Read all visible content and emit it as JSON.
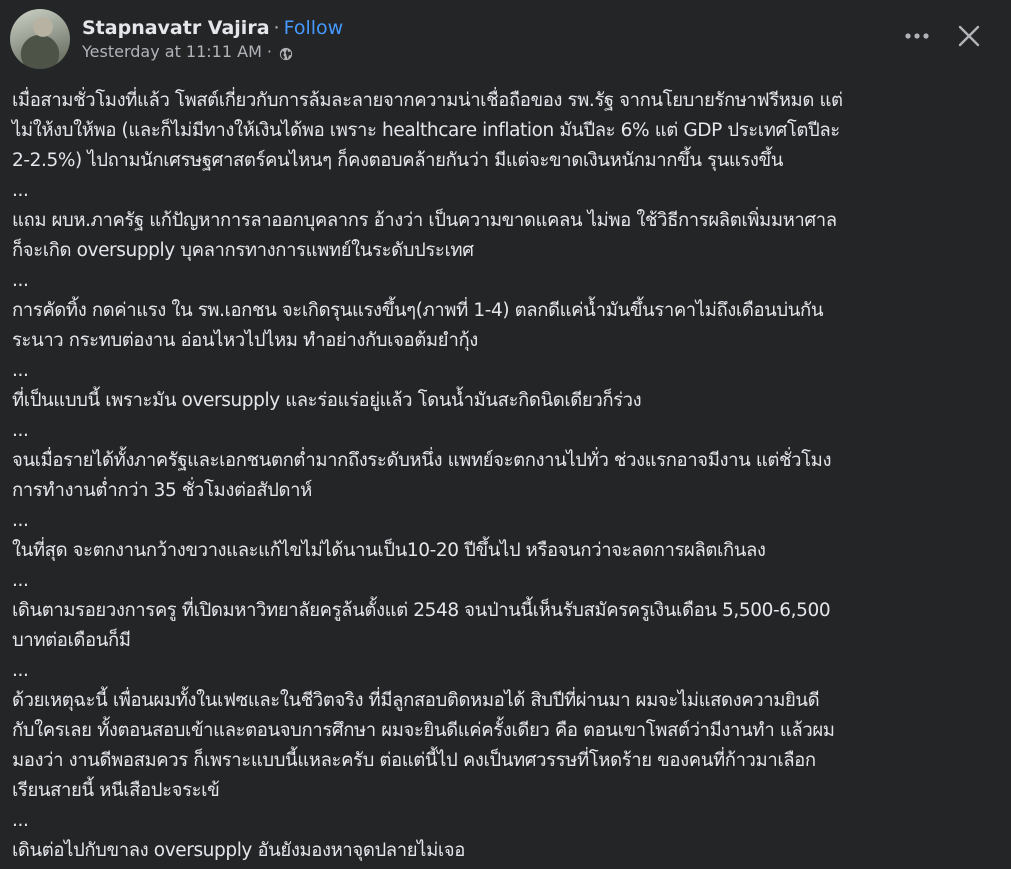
{
  "author": {
    "name": "Stapnavatr Vajira",
    "separator": "·",
    "follow_label": "Follow",
    "timestamp": "Yesterday at 11:11 AM",
    "time_separator": "·",
    "privacy_icon": "globe-icon"
  },
  "actions": {
    "more_icon": "more-horizontal-icon",
    "close_icon": "close-icon"
  },
  "lines": [
    "เมื่อสามชั่วโมงที่แล้ว โพสต์เกี่ยวกับการล้มละลายจากความน่าเชื่อถือของ รพ.รัฐ จากนโยบายรักษาฟรีหมด แต่",
    "ไม่ให้งบให้พอ (และก็ไม่มีทางให้เงินได้พอ เพราะ healthcare inflation มันปีละ 6% แต่ GDP ประเทศโตปีละ",
    "2-2.5%) ไปถามนักเศรษฐศาสตร์คนไหนๆ ก็คงตอบคล้ายกันว่า มีแต่จะขาดเงินหนักมากขึ้น รุนแรงขึ้น",
    "...",
    "แถม ผบห.ภาครัฐ แก้ปัญหาการลาออกบุคลากร อ้างว่า เป็นความขาดแคลน ไม่พอ ใช้วิธีการผลิตเพิ่มมหาศาล",
    "ก็จะเกิด oversupply บุคลากรทางการแพทย์ในระดับประเทศ",
    "...",
    "การคัดทิ้ง กดค่าแรง ใน รพ.เอกชน จะเกิดรุนแรงขึ้นๆ(ภาพที่ 1-4) ตลกดีแค่น้ำมันขึ้นราคาไม่ถึงเดือนบ่นกัน",
    "ระนาว กระทบต่องาน อ่อนไหวไปไหม ทำอย่างกับเจอต้มยำกุ้ง",
    "...",
    "ที่เป็นแบบนี้ เพราะมัน oversupply และร่อแร่อยู่แล้ว โดนน้ำมันสะกิดนิดเดียวก็ร่วง",
    "...",
    "จนเมื่อรายได้ทั้งภาครัฐและเอกชนตกต่ำมากถึงระดับหนึ่ง แพทย์จะตกงานไปทั่ว ช่วงแรกอาจมีงาน แต่ชั่วโมง",
    "การทำงานต่ำกว่า 35 ชั่วโมงต่อสัปดาห์",
    "...",
    "ในที่สุด จะตกงานกว้างขวางและแก้ไขไม่ได้นานเป็น10-20 ปีขึ้นไป หรือจนกว่าจะลดการผลิตเกินลง",
    "...",
    "เดินตามรอยวงการครู ที่เปิดมหาวิทยาลัยครูล้นตั้งแต่ 2548 จนป่านนี้เห็นรับสมัครครูเงินเดือน 5,500-6,500",
    "บาทต่อเดือนก็มี",
    "...",
    "ด้วยเหตุฉะนี้ เพื่อนผมทั้งในเฟซและในชีวิตจริง ที่มีลูกสอบติดหมอได้ สิบปีที่ผ่านมา ผมจะไม่แสดงความยินดี",
    "กับใครเลย ทั้งตอนสอบเข้าและตอนจบการศึกษา ผมจะยินดีแค่ครั้งเดียว คือ ตอนเขาโพสต์ว่ามีงานทำ แล้วผม",
    "มองว่า งานดีพอสมควร ก็เพราะแบบนี้แหละครับ ต่อแต่นี้ไป คงเป็นทศวรรษที่โหดร้าย ของคนที่ก้าวมาเลือก",
    "เรียนสายนี้ หนีเสือปะจระเข้",
    "...",
    "เดินต่อไปกับขาลง oversupply อันยังมองหาจุดปลายไม่เจอ"
  ]
}
